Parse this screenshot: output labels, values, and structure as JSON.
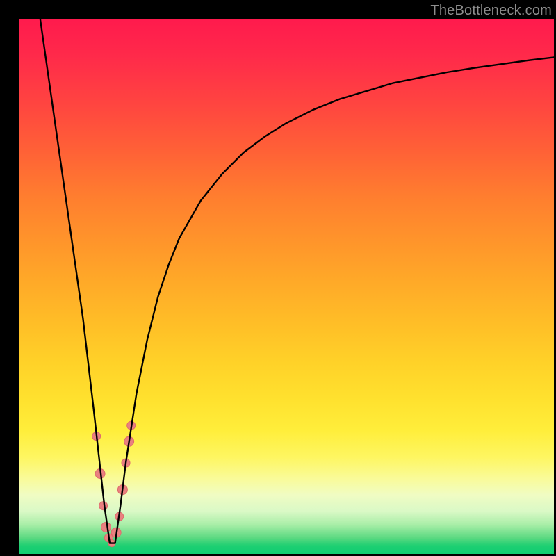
{
  "watermark": "TheBottleneck.com",
  "colors": {
    "curve": "#000000",
    "points": "#e98080",
    "points_stroke": "#de6b6b",
    "frame": "#000000"
  },
  "chart_data": {
    "type": "line",
    "title": "",
    "xlabel": "",
    "ylabel": "",
    "xlim": [
      0,
      100
    ],
    "ylim": [
      0,
      100
    ],
    "grid": false,
    "background_gradient": "red-to-green vertical",
    "series": [
      {
        "name": "bottleneck-curve",
        "comment": "Approximate percentage bottleneck curve with sharp minimum near x≈17–18; y read as 0–100 from bottom (green) to top (red). Values estimated from pixel positions.",
        "x": [
          4,
          6,
          8,
          10,
          12,
          14,
          15,
          16,
          17,
          18,
          19,
          20,
          22,
          24,
          26,
          28,
          30,
          34,
          38,
          42,
          46,
          50,
          55,
          60,
          65,
          70,
          75,
          80,
          85,
          90,
          95,
          100
        ],
        "y": [
          100,
          86,
          72,
          58,
          44,
          27,
          18,
          9,
          2,
          2,
          9,
          17,
          30,
          40,
          48,
          54,
          59,
          66,
          71,
          75,
          78,
          80.5,
          83,
          85,
          86.5,
          88,
          89,
          90,
          90.8,
          91.5,
          92.2,
          92.8
        ]
      }
    ],
    "scatter": {
      "name": "highlighted-points",
      "comment": "Salmon dots clustered on both flanks of the valley near the minimum.",
      "points": [
        {
          "x": 14.5,
          "y": 22,
          "r": 6
        },
        {
          "x": 15.2,
          "y": 15,
          "r": 7
        },
        {
          "x": 15.8,
          "y": 9,
          "r": 6
        },
        {
          "x": 16.3,
          "y": 5,
          "r": 7
        },
        {
          "x": 16.8,
          "y": 3,
          "r": 6
        },
        {
          "x": 17.4,
          "y": 2,
          "r": 5
        },
        {
          "x": 18.2,
          "y": 4,
          "r": 7
        },
        {
          "x": 18.8,
          "y": 7,
          "r": 6
        },
        {
          "x": 19.4,
          "y": 12,
          "r": 7
        },
        {
          "x": 20.0,
          "y": 17,
          "r": 6
        },
        {
          "x": 20.6,
          "y": 21,
          "r": 7
        },
        {
          "x": 21.0,
          "y": 24,
          "r": 6
        }
      ]
    }
  }
}
